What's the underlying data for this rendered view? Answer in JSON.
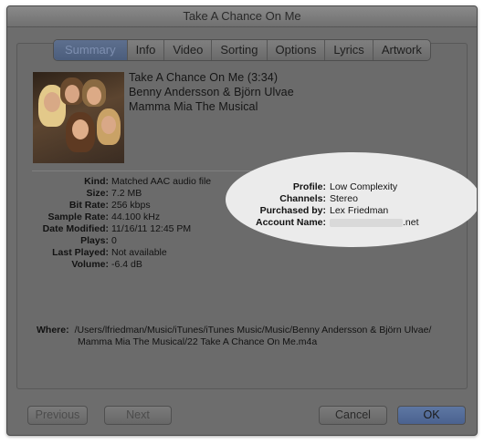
{
  "window": {
    "title": "Take A Chance On Me"
  },
  "tabs": [
    "Summary",
    "Info",
    "Video",
    "Sorting",
    "Options",
    "Lyrics",
    "Artwork"
  ],
  "active_tab": "Summary",
  "song": {
    "title_line": "Take A Chance On Me (3:34)",
    "artist": "Benny Andersson & Björn Ulvae",
    "album": "Mamma Mia The Musical"
  },
  "details_left": [
    {
      "label": "Kind:",
      "value": "Matched AAC audio file"
    },
    {
      "label": "Size:",
      "value": "7.2 MB"
    },
    {
      "label": "Bit Rate:",
      "value": "256 kbps"
    },
    {
      "label": "Sample Rate:",
      "value": "44.100 kHz"
    },
    {
      "label": "Date Modified:",
      "value": "11/16/11 12:45 PM"
    },
    {
      "label": "Plays:",
      "value": "0"
    },
    {
      "label": "Last Played:",
      "value": "Not available"
    },
    {
      "label": "Volume:",
      "value": "-6.4 dB"
    }
  ],
  "details_right": [
    {
      "label": "Profile:",
      "value": "Low Complexity"
    },
    {
      "label": "Channels:",
      "value": "Stereo"
    },
    {
      "label": "Purchased by:",
      "value": "Lex Friedman"
    },
    {
      "label": "Account Name:",
      "value": ".net"
    }
  ],
  "where": {
    "label": "Where:",
    "line1": "/Users/lfriedman/Music/iTunes/iTunes Music/Music/Benny Andersson & Björn Ulvae/",
    "line2": "Mamma Mia The Musical/22 Take A Chance On Me.m4a"
  },
  "buttons": {
    "previous": "Previous",
    "next": "Next",
    "cancel": "Cancel",
    "ok": "OK"
  }
}
